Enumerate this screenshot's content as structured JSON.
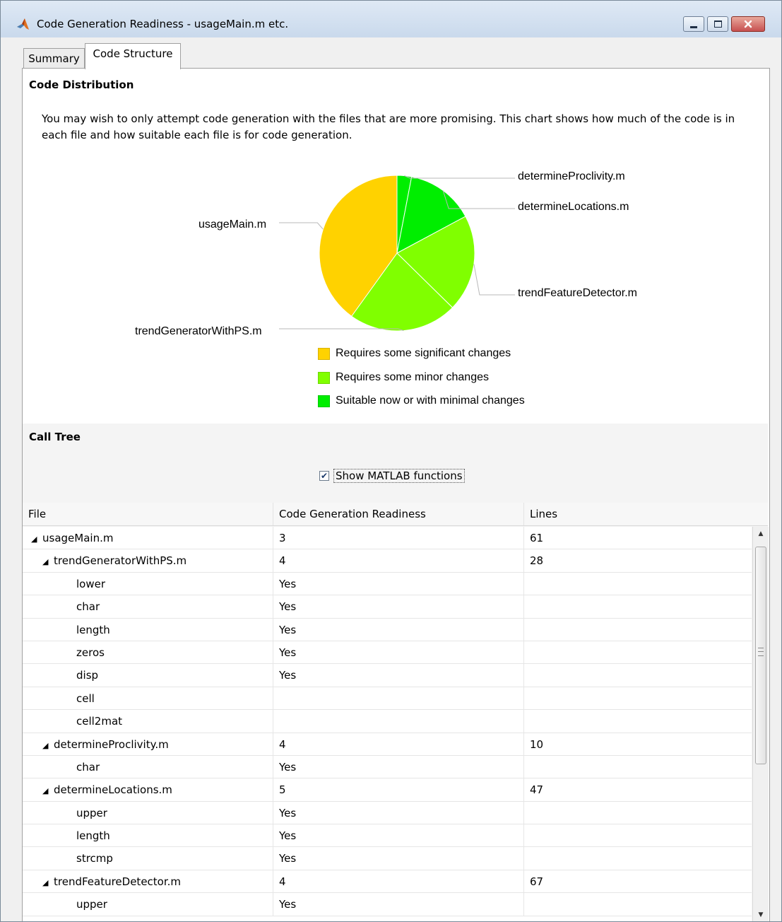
{
  "window": {
    "title": "Code Generation Readiness - usageMain.m etc.",
    "icon": "matlab-logo-icon"
  },
  "tabs": [
    {
      "label": "Summary",
      "active": false
    },
    {
      "label": "Code Structure",
      "active": true
    }
  ],
  "code_distribution": {
    "title": "Code Distribution",
    "description": "You may wish to only attempt code generation with the files that are more promising. This chart shows how much of the code is in each file and how suitable each file is for code generation."
  },
  "chart_data": {
    "type": "pie",
    "slices": [
      {
        "label": "determineProclivity.m",
        "value": 10,
        "category": "Suitable now or with minimal changes"
      },
      {
        "label": "determineLocations.m",
        "value": 47,
        "category": "Suitable now or with minimal changes"
      },
      {
        "label": "trendFeatureDetector.m",
        "value": 67,
        "category": "Requires some minor changes"
      },
      {
        "label": "trendGeneratorWithPS.m",
        "value": 75,
        "category": "Requires some minor changes"
      },
      {
        "label": "usageMain.m",
        "value": 133,
        "category": "Requires some significant changes"
      }
    ],
    "legend": [
      {
        "label": "Requires some significant changes",
        "color": "#ffd200"
      },
      {
        "label": "Requires some minor changes",
        "color": "#80ff00"
      },
      {
        "label": "Suitable now or with minimal changes",
        "color": "#00ee00"
      }
    ]
  },
  "call_tree": {
    "title": "Call Tree",
    "show_matlab_functions": {
      "label": "Show MATLAB functions",
      "checked": true
    },
    "columns": [
      "File",
      "Code Generation Readiness",
      "Lines"
    ],
    "rows": [
      {
        "level": 0,
        "expanded": true,
        "name": "usageMain.m",
        "readiness": "3",
        "lines": "61"
      },
      {
        "level": 1,
        "expanded": true,
        "name": "trendGeneratorWithPS.m",
        "readiness": "4",
        "lines": "28"
      },
      {
        "level": 2,
        "name": "lower",
        "readiness": "Yes",
        "lines": ""
      },
      {
        "level": 2,
        "name": "char",
        "readiness": "Yes",
        "lines": ""
      },
      {
        "level": 2,
        "name": "length",
        "readiness": "Yes",
        "lines": ""
      },
      {
        "level": 2,
        "name": "zeros",
        "readiness": "Yes",
        "lines": ""
      },
      {
        "level": 2,
        "name": "disp",
        "readiness": "Yes",
        "lines": ""
      },
      {
        "level": 2,
        "name": "cell",
        "readiness": "",
        "lines": ""
      },
      {
        "level": 2,
        "name": "cell2mat",
        "readiness": "",
        "lines": ""
      },
      {
        "level": 1,
        "expanded": true,
        "name": "determineProclivity.m",
        "readiness": "4",
        "lines": "10"
      },
      {
        "level": 2,
        "name": "char",
        "readiness": "Yes",
        "lines": ""
      },
      {
        "level": 1,
        "expanded": true,
        "name": "determineLocations.m",
        "readiness": "5",
        "lines": "47"
      },
      {
        "level": 2,
        "name": "upper",
        "readiness": "Yes",
        "lines": ""
      },
      {
        "level": 2,
        "name": "length",
        "readiness": "Yes",
        "lines": ""
      },
      {
        "level": 2,
        "name": "strcmp",
        "readiness": "Yes",
        "lines": ""
      },
      {
        "level": 1,
        "expanded": true,
        "name": "trendFeatureDetector.m",
        "readiness": "4",
        "lines": "67"
      },
      {
        "level": 2,
        "name": "upper",
        "readiness": "Yes",
        "lines": ""
      }
    ]
  }
}
